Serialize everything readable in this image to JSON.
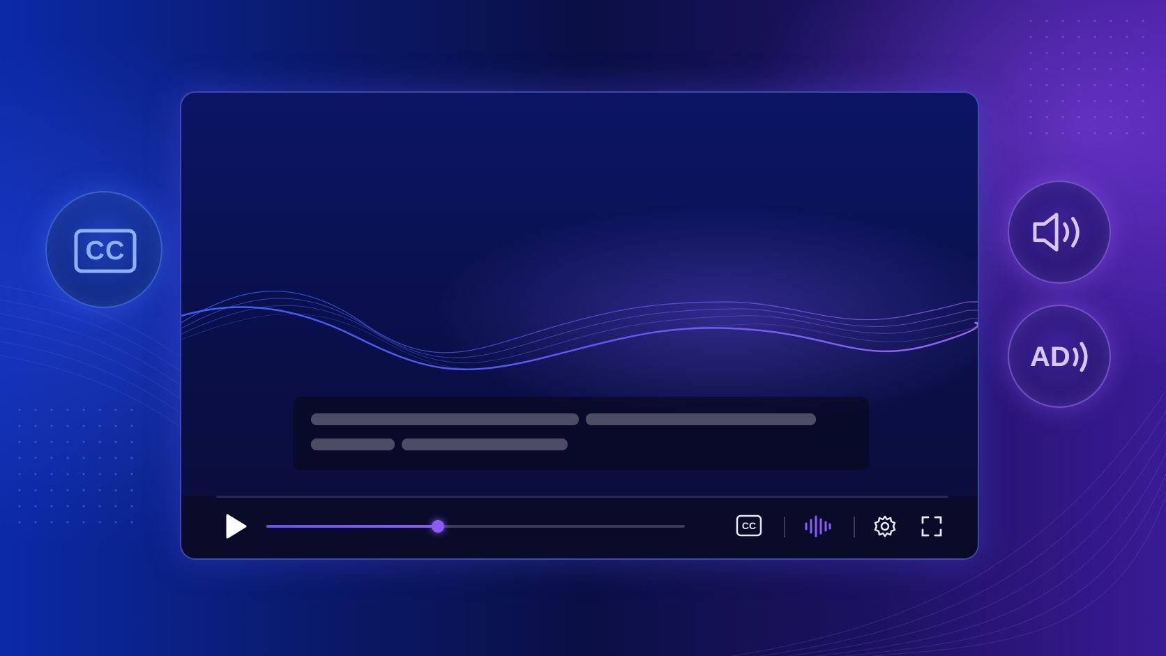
{
  "colors": {
    "accent_purple": "#8a5cff",
    "accent_blue": "#3f6bff",
    "caption_bar": "#4a4d63",
    "icon_white": "#e8e9f5"
  },
  "side_buttons": {
    "captions": {
      "label": "CC",
      "icon": "closed-captions-icon"
    },
    "volume": {
      "icon": "speaker-volume-icon"
    },
    "audio_description": {
      "label": "AD",
      "icon": "audio-description-icon"
    }
  },
  "player": {
    "progress": 0.41,
    "controls": {
      "play": {
        "icon": "play-icon"
      },
      "captions": {
        "label": "CC",
        "icon": "closed-captions-icon"
      },
      "audio": {
        "icon": "audio-waveform-icon"
      },
      "settings": {
        "icon": "gear-icon"
      },
      "fullscreen": {
        "icon": "fullscreen-icon"
      }
    }
  }
}
